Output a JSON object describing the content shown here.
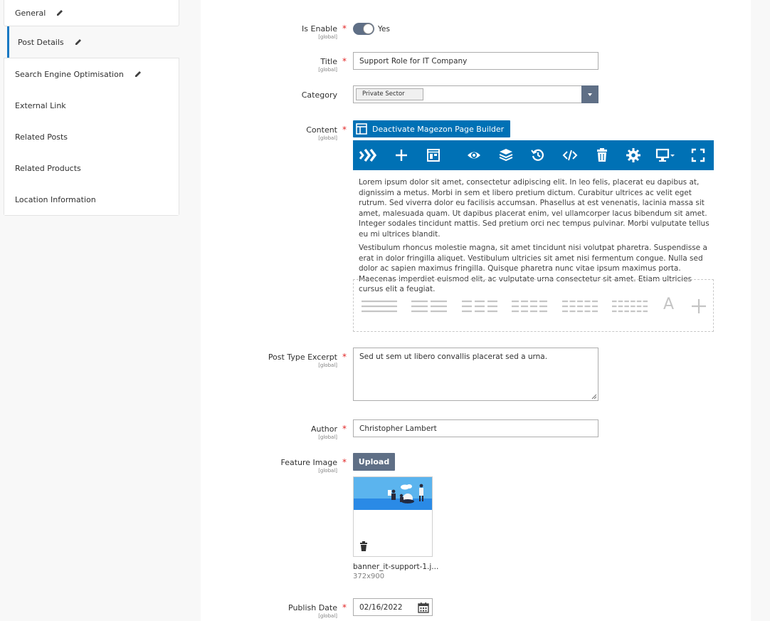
{
  "sidebar": {
    "items": [
      {
        "label": "General",
        "edit_icon": "pencil-icon"
      },
      {
        "label": "Post Details",
        "edit_icon": "pencil-icon"
      },
      {
        "label": "Search Engine Optimisation",
        "edit_icon": "pencil-icon"
      },
      {
        "label": "External Link"
      },
      {
        "label": "Related Posts"
      },
      {
        "label": "Related Products"
      },
      {
        "label": "Location Information"
      }
    ]
  },
  "scope_label": "[global]",
  "fields": {
    "is_enable": {
      "label": "Is Enable",
      "value": "Yes",
      "checked": true
    },
    "title": {
      "label": "Title",
      "value": "Support Role for IT Company"
    },
    "category": {
      "label": "Category",
      "selected": "Private Sector"
    },
    "content": {
      "label": "Content",
      "toggle_button": "Deactivate Magezon Page Builder",
      "toolbar_icons": [
        "magezon-logo-icon",
        "add-icon",
        "template-icon",
        "preview-icon",
        "layers-icon",
        "history-icon",
        "code-icon",
        "delete-icon",
        "settings-icon",
        "device-icon",
        "fullscreen-icon"
      ],
      "paragraphs": [
        "Lorem ipsum dolor sit amet, consectetur adipiscing elit. In leo felis, placerat eu dapibus at, dignissim a metus. Morbi in sem et libero pretium dictum. Curabitur ultrices ac velit eget rutrum. Sed viverra dolor eu facilisis accumsan. Phasellus at est venenatis, lacinia massa sit amet, malesuada quam. Ut dapibus placerat enim, vel ullamcorper lacus bibendum sit amet. Integer sodales tincidunt mattis. Sed pretium orci nec tempus pulvinar. Morbi vulputate tellus eu mi ultrices blandit.",
        "Vestibulum rhoncus molestie magna, sit amet tincidunt nisi volutpat pharetra. Suspendisse a erat in dolor fringilla aliquet. Vestibulum ultricies sit amet nisi fermentum congue. Nulla sed dolor ac sapien maximus fringilla. Quisque pharetra nunc vitae ipsum maximus porta. Maecenas imperdiet euismod elit, ac vulputate urna consectetur sit amet. Etiam ultricies cursus elit a feugiat."
      ],
      "layout_text_glyph": "A"
    },
    "excerpt": {
      "label": "Post Type Excerpt",
      "value": "Sed ut sem ut libero convallis placerat sed a urna."
    },
    "author": {
      "label": "Author",
      "value": "Christopher Lambert"
    },
    "feature_image": {
      "label": "Feature Image",
      "upload_label": "Upload",
      "file_name": "banner_it-support-1.j...",
      "dimensions": "372x900"
    },
    "publish_date": {
      "label": "Publish Date",
      "value": "02/16/2022"
    }
  },
  "colors": {
    "accent": "#0071b5",
    "button": "#5f6f86",
    "required": "#e22626"
  }
}
